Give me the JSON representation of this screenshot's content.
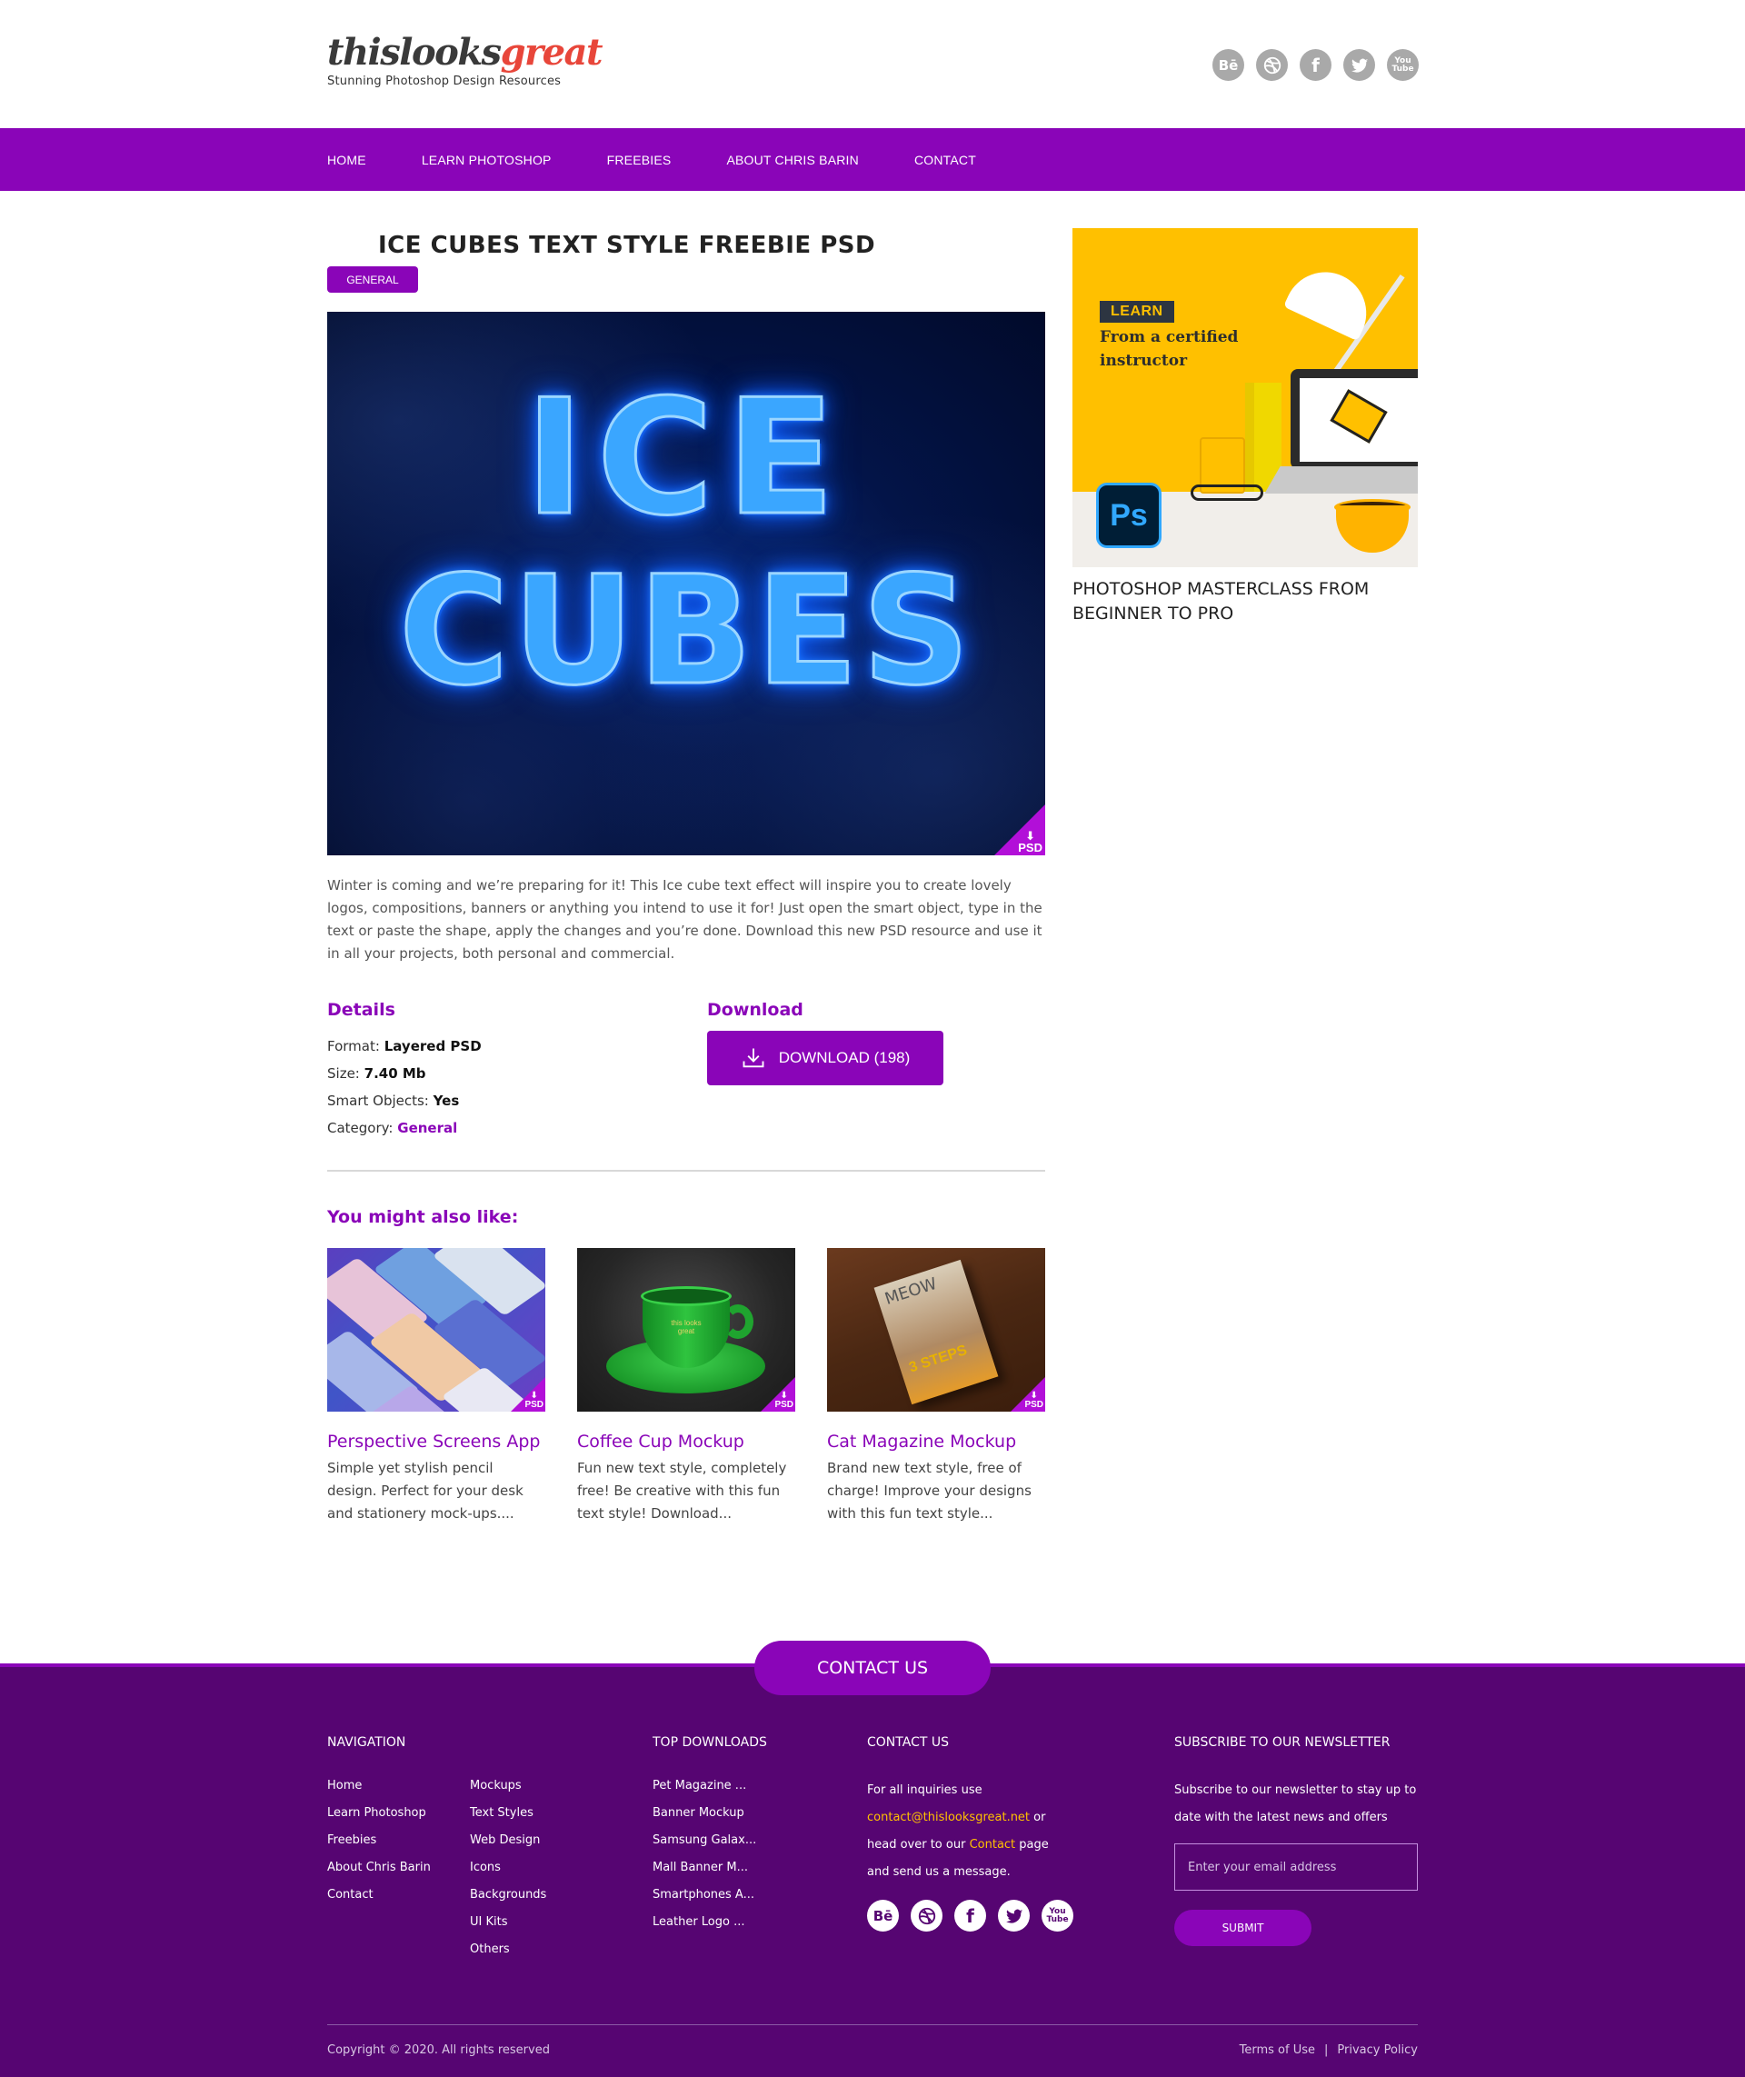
{
  "header": {
    "logo_main": "thislooks",
    "logo_accent": "great",
    "tagline": "Stunning Photoshop Design Resources",
    "social": [
      {
        "icon": "behance-icon",
        "glyph": "Bē"
      },
      {
        "icon": "dribbble-icon",
        "glyph": ""
      },
      {
        "icon": "facebook-icon",
        "glyph": "f"
      },
      {
        "icon": "twitter-icon",
        "glyph": ""
      },
      {
        "icon": "youtube-icon",
        "glyph": "You Tube"
      }
    ]
  },
  "nav": {
    "items": [
      "HOME",
      "LEARN PHOTOSHOP",
      "FREEBIES",
      "ABOUT CHRIS BARIN",
      "CONTACT"
    ]
  },
  "post": {
    "title": "ICE CUBES TEXT STYLE FREEBIE PSD",
    "category_badge": "GENERAL",
    "hero_line1": "ICE",
    "hero_line2": "CUBES",
    "psd_label": "PSD",
    "description": "Winter is coming and we’re preparing for it! This Ice cube text effect will inspire you to create lovely logos, compositions, banners or anything you intend to use it for! Just open the smart object, type in the text or paste the shape, apply the changes and you’re done. Download this new PSD resource and use it in all your projects, both personal and commercial.",
    "details_heading": "Details",
    "details": {
      "format_label": "Format:",
      "format_value": "Layered PSD",
      "size_label": "Size:",
      "size_value": "7.40 Mb",
      "smart_label": "Smart Objects:",
      "smart_value": "Yes",
      "category_label": "Category:",
      "category_value": "General"
    },
    "download_heading": "Download",
    "download_button": "DOWNLOAD (198)",
    "related_heading": "You might also like:",
    "related": [
      {
        "title": "Perspective Screens App",
        "desc": "Simple yet stylish pencil design. Perfect for your desk and stationery mock-ups...."
      },
      {
        "title": "Coffee Cup Mockup",
        "desc": "Fun new text style, completely free! Be creative with this fun text style! Download..."
      },
      {
        "title": "Cat Magazine Mockup",
        "desc": "Brand new text style, free of charge! Improve your designs with this fun text style..."
      }
    ],
    "coffee_logo": "this looks great",
    "mag_title": "MEOW",
    "mag_steps": "3 STEPS"
  },
  "sidebar": {
    "ad_badge": "LEARN",
    "ad_line1": "From a certified",
    "ad_line2": "instructor",
    "ad_ps": "Ps",
    "title": "PHOTOSHOP MASTERCLASS FROM BEGINNER TO PRO"
  },
  "footer": {
    "contact_pill": "CONTACT US",
    "nav_heading": "NAVIGATION",
    "nav_col1": [
      "Home",
      "Learn Photoshop",
      "Freebies",
      "About Chris Barin",
      "Contact"
    ],
    "nav_col2": [
      "Mockups",
      "Text Styles",
      "Web Design",
      "Icons",
      "Backgrounds",
      "UI Kits",
      "Others"
    ],
    "downloads_heading": "TOP DOWNLOADS",
    "downloads": [
      "Pet Magazine ...",
      "Banner Mockup",
      "Samsung Galax...",
      "Mall Banner M...",
      "Smartphones A...",
      "Leather Logo ..."
    ],
    "contact_heading": "CONTACT US",
    "contact_p1": "For all inquiries use",
    "contact_email": "contact@thislooksgreat.net",
    "contact_p2": " or",
    "contact_p3": "head over to our ",
    "contact_link": "Contact",
    "contact_p4": " page",
    "contact_p5": "and send us a message.",
    "newsletter_heading": "SUBSCRIBE TO OUR NEWSLETTER",
    "newsletter_line1": "Subscribe to our newsletter to stay up to",
    "newsletter_line2": "date with the latest news and offers",
    "email_placeholder": "Enter your email address",
    "submit": "SUBMIT",
    "copyright": "Copyright © 2020. All rights reserved",
    "terms": "Terms of Use",
    "sep": "|",
    "privacy": "Privacy Policy"
  },
  "colors": {
    "brand_purple": "#8a05b8",
    "footer_purple": "#560572",
    "accent_red": "#e8463a",
    "accent_yellow": "#ffc000"
  }
}
